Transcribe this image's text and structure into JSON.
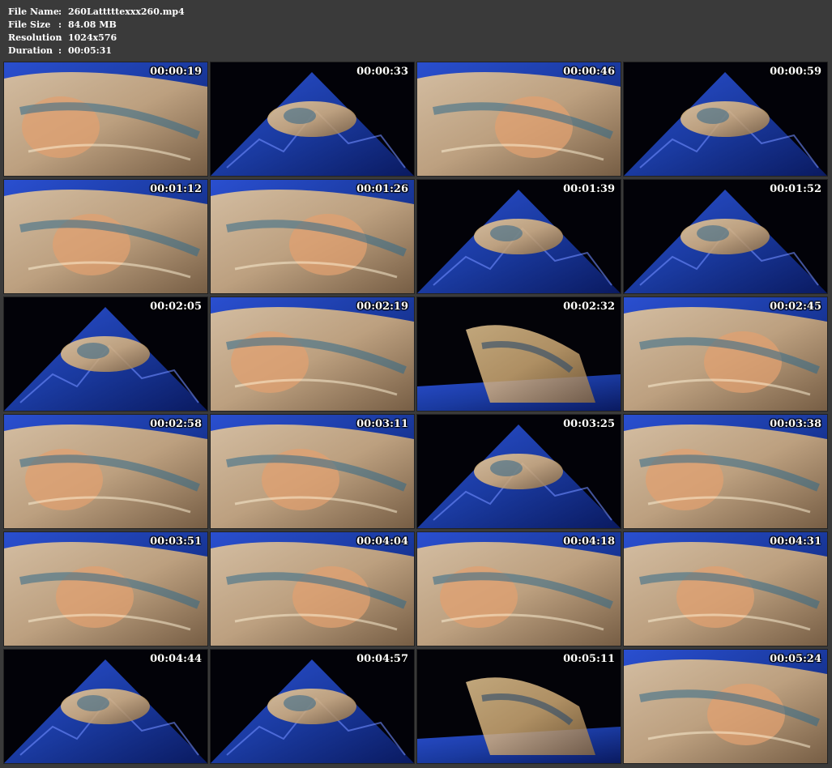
{
  "file_info": {
    "rows": [
      {
        "label": "File Name",
        "sep": ":",
        "value": "260Latttttexxx260.mp4"
      },
      {
        "label": "File Size",
        "sep": ":",
        "value": "84.08 MB"
      },
      {
        "label": "Resolution",
        "sep": ":",
        "value": "1024x576"
      },
      {
        "label": "Duration",
        "sep": ":",
        "value": "00:05:31"
      }
    ]
  },
  "thumbnails": [
    {
      "time": "00:00:19",
      "scene": "closeup"
    },
    {
      "time": "00:00:33",
      "scene": "pile"
    },
    {
      "time": "00:00:46",
      "scene": "closeup"
    },
    {
      "time": "00:00:59",
      "scene": "pile"
    },
    {
      "time": "00:01:12",
      "scene": "closeup"
    },
    {
      "time": "00:01:26",
      "scene": "closeup"
    },
    {
      "time": "00:01:39",
      "scene": "pile"
    },
    {
      "time": "00:01:52",
      "scene": "pile"
    },
    {
      "time": "00:02:05",
      "scene": "pile"
    },
    {
      "time": "00:02:19",
      "scene": "closeup"
    },
    {
      "time": "00:02:32",
      "scene": "dark"
    },
    {
      "time": "00:02:45",
      "scene": "closeup"
    },
    {
      "time": "00:02:58",
      "scene": "closeup"
    },
    {
      "time": "00:03:11",
      "scene": "closeup"
    },
    {
      "time": "00:03:25",
      "scene": "pile"
    },
    {
      "time": "00:03:38",
      "scene": "closeup"
    },
    {
      "time": "00:03:51",
      "scene": "closeup"
    },
    {
      "time": "00:04:04",
      "scene": "closeup"
    },
    {
      "time": "00:04:18",
      "scene": "closeup"
    },
    {
      "time": "00:04:31",
      "scene": "closeup"
    },
    {
      "time": "00:04:44",
      "scene": "pile"
    },
    {
      "time": "00:04:57",
      "scene": "pile"
    },
    {
      "time": "00:05:11",
      "scene": "dark"
    },
    {
      "time": "00:05:24",
      "scene": "closeup"
    }
  ],
  "colors": {
    "background": "#3a3a3a",
    "text": "#ffffff",
    "blue_sheet": "#1a3aa0",
    "latex": "#d9b27a"
  }
}
